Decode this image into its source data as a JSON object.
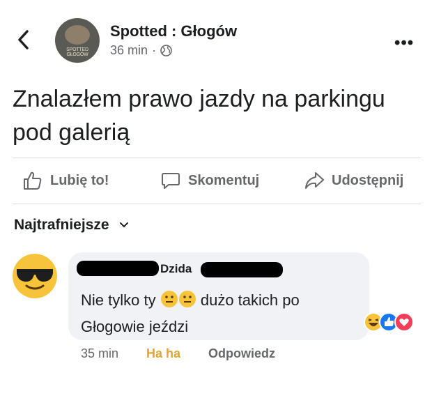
{
  "header": {
    "page_name": "Spotted : Głogów",
    "time": "36 min",
    "separator": "·",
    "avatar_text": "SPOTTED GŁOGÓW"
  },
  "post": {
    "text": "Znalazłem prawo jazdy na parkingu pod galerią"
  },
  "actions": {
    "like": "Lubię to!",
    "comment": "Skomentuj",
    "share": "Udostępnij"
  },
  "comments_sort": {
    "label": "Najtrafniejsze"
  },
  "comment": {
    "author": "Dzida",
    "text_part1": "Nie tylko ty",
    "text_part2": "dużo takich po Głogowie jeździ",
    "time": "35 min",
    "reaction_label": "Ha ha",
    "reply_label": "Odpowiedz",
    "reactions": [
      "haha",
      "like",
      "love"
    ]
  },
  "colors": {
    "text": "#1c1e21",
    "secondary": "#65676b",
    "haha": "#e0a72d",
    "bubble": "#f0f2f5",
    "like_blue": "#1877f2",
    "love_red": "#f33e58"
  }
}
